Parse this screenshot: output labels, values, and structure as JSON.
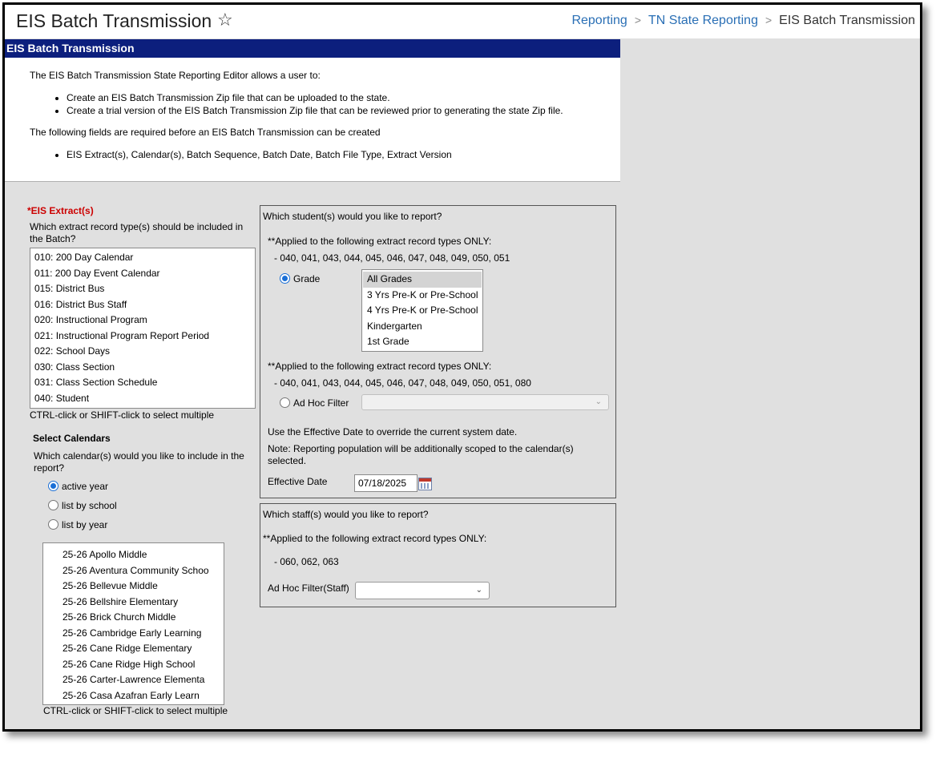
{
  "header": {
    "title": "EIS Batch Transmission",
    "breadcrumb": [
      "Reporting",
      "TN State Reporting",
      "EIS Batch Transmission"
    ]
  },
  "section_title": "EIS Batch Transmission",
  "info": {
    "intro": "The EIS Batch Transmission State Reporting Editor allows a user to:",
    "bullets": [
      "Create an EIS Batch Transmission Zip file that can be uploaded to the state.",
      "Create a trial version of the EIS Batch Transmission Zip file that can be reviewed prior to generating the state Zip file."
    ],
    "required_intro": "The following fields are required before an EIS Batch Transmission can be created",
    "required_fields": "EIS Extract(s), Calendar(s), Batch Sequence, Batch Date, Batch File Type, Extract Version"
  },
  "extracts": {
    "label": "*EIS Extract(s)",
    "question": "Which extract record type(s) should be included in the Batch?",
    "options": [
      "010: 200 Day Calendar",
      "011: 200 Day Event Calendar",
      "015: District Bus",
      "016: District Bus Staff",
      "020: Instructional Program",
      "021: Instructional Program Report Period",
      "022: School Days",
      "030: Class Section",
      "031: Class Section Schedule",
      "040: Student"
    ],
    "hint": "CTRL-click or SHIFT-click to select multiple"
  },
  "calendars": {
    "title": "Select Calendars",
    "question": "Which calendar(s) would you like to include in the report?",
    "radios": [
      "active year",
      "list by school",
      "list by year"
    ],
    "selected": "active year",
    "options": [
      "25-26 Apollo Middle",
      "25-26 Aventura Community Schoo",
      "25-26 Bellevue Middle",
      "25-26 Bellshire Elementary",
      "25-26 Brick Church Middle",
      "25-26 Cambridge Early Learning",
      "25-26 Cane Ridge Elementary",
      "25-26 Cane Ridge High School",
      "25-26 Carter-Lawrence Elementa",
      "25-26 Casa Azafran Early Learn"
    ],
    "hint": "CTRL-click or SHIFT-click to select multiple"
  },
  "students": {
    "question": "Which student(s) would you like to report?",
    "applied_note": "**Applied to the following extract record types ONLY:",
    "grade_types": "- 040, 041, 043, 044, 045, 046, 047, 048, 049, 050, 051",
    "grade_label": "Grade",
    "grades": [
      "All Grades",
      "3 Yrs Pre-K or Pre-School",
      "4 Yrs Pre-K or Pre-School",
      "Kindergarten",
      "1st Grade"
    ],
    "grade_selected": "All Grades",
    "adhoc_types": "- 040, 041, 043, 044, 045, 046, 047, 048, 049, 050, 051, 080",
    "adhoc_label": "Ad Hoc Filter",
    "effective_note": "Use the Effective Date to override the current system date.",
    "scope_note": "Note: Reporting population will be additionally scoped to the calendar(s) selected.",
    "effective_label": "Effective Date",
    "effective_value": "07/18/2025"
  },
  "staff": {
    "question": "Which staff(s) would you like to report?",
    "applied_note": "**Applied to the following extract record types ONLY:",
    "types": "- 060, 062, 063",
    "filter_label": "Ad Hoc Filter(Staff)"
  },
  "colors": {
    "header_bar": "#0c1f7d",
    "link": "#2a6fb5",
    "required": "#cc0000",
    "radio": "#1a6fd6"
  }
}
